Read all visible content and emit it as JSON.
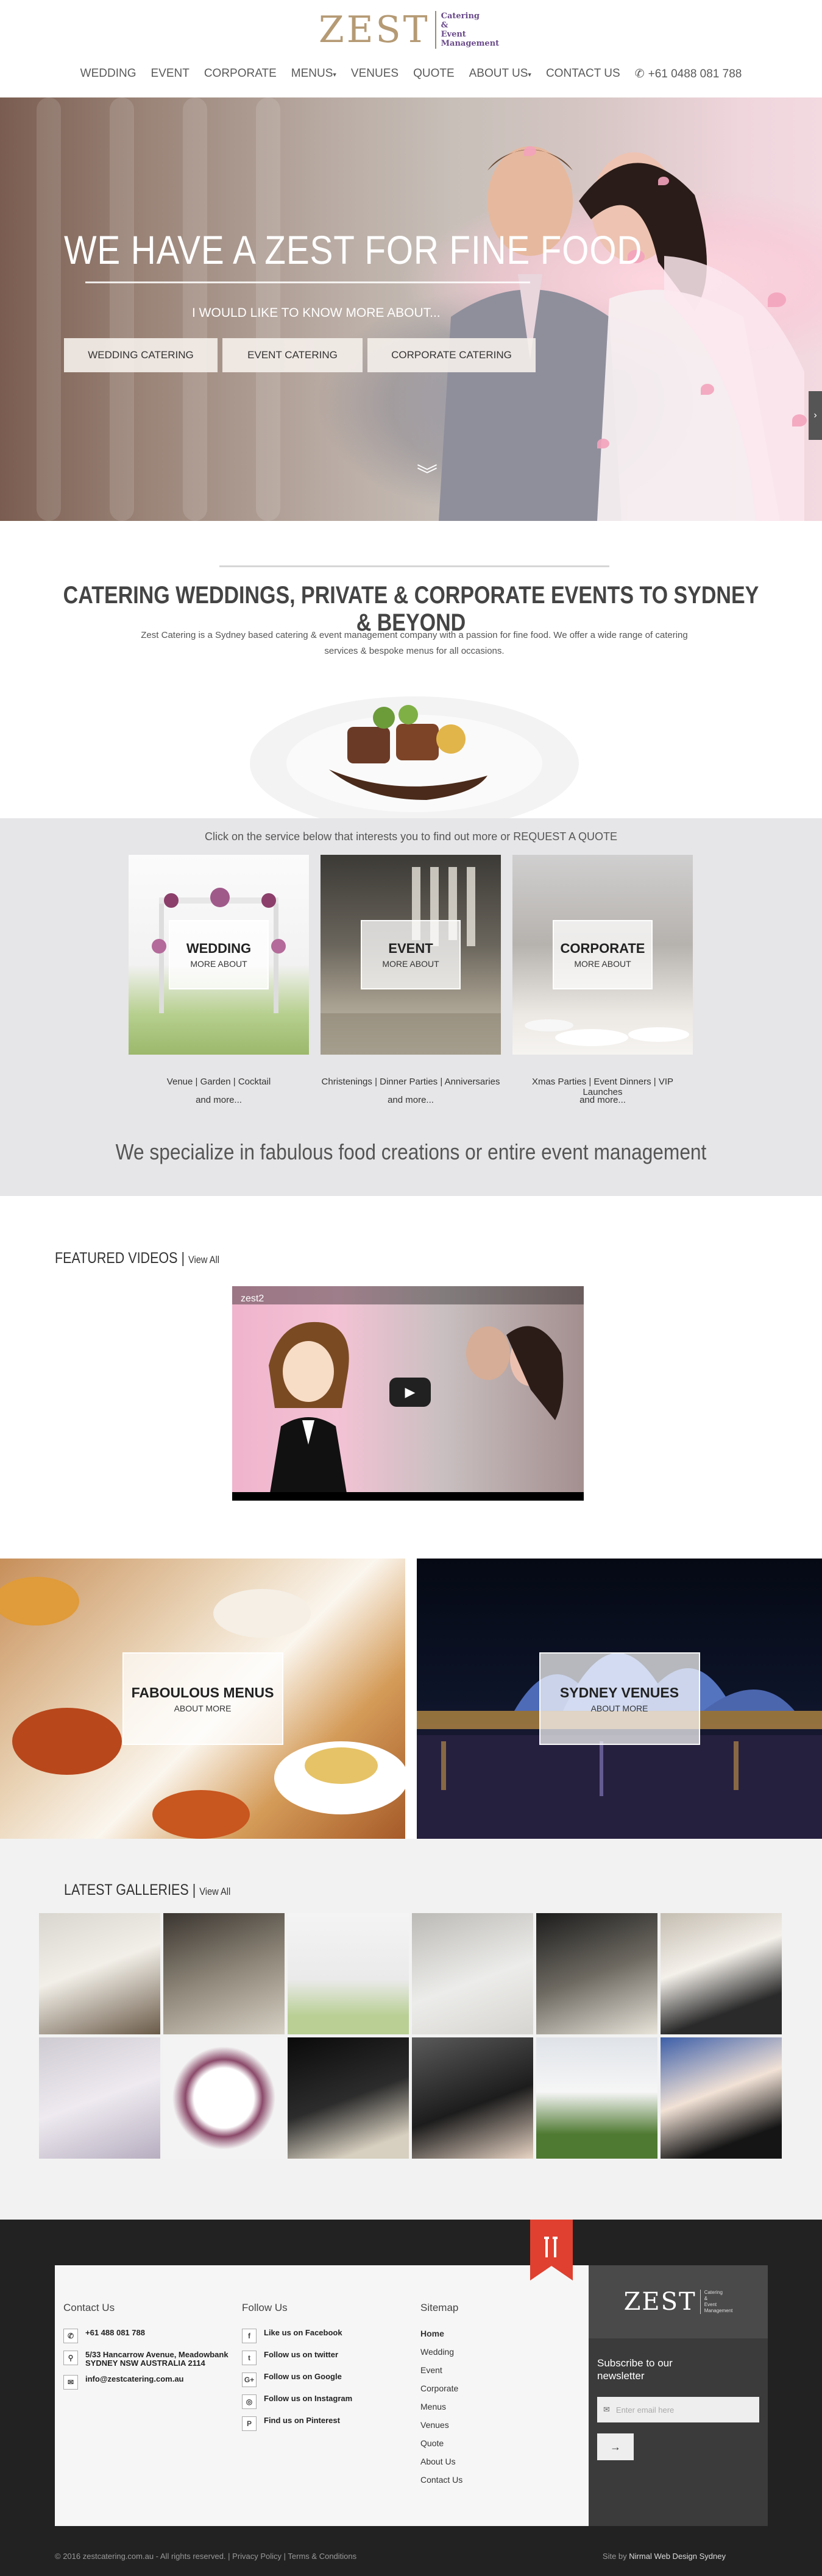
{
  "brand": {
    "name": "ZEST",
    "tagline": [
      "Catering",
      "&",
      "Event",
      "Management"
    ]
  },
  "nav": {
    "items": [
      {
        "label": "WEDDING",
        "dropdown": false
      },
      {
        "label": "EVENT",
        "dropdown": false
      },
      {
        "label": "CORPORATE",
        "dropdown": false
      },
      {
        "label": "MENUS",
        "dropdown": true
      },
      {
        "label": "VENUES",
        "dropdown": false
      },
      {
        "label": "QUOTE",
        "dropdown": false
      },
      {
        "label": "ABOUT US",
        "dropdown": true
      },
      {
        "label": "CONTACT US",
        "dropdown": false
      }
    ],
    "phone": "+61 0488 081 788"
  },
  "hero": {
    "title": "WE HAVE A ZEST FOR FINE FOOD",
    "subtitle": "I WOULD LIKE TO KNOW MORE ABOUT...",
    "buttons": [
      "WEDDING CATERING",
      "EVENT CATERING",
      "CORPORATE CATERING"
    ]
  },
  "intro": {
    "title": "CATERING WEDDINGS, PRIVATE & CORPORATE EVENTS TO SYDNEY & BEYOND",
    "text": "Zest Catering is a Sydney based catering & event management company with a passion for fine food. We offer a wide range of catering services & bespoke menus for all occasions."
  },
  "services": {
    "lead": "Click on the service below that interests you to find out more or REQUEST A QUOTE",
    "cards": [
      {
        "title": "WEDDING",
        "more": "MORE ABOUT",
        "tags": "Venue | Garden | Cocktail",
        "and_more": "and more..."
      },
      {
        "title": "EVENT",
        "more": "MORE ABOUT",
        "tags": "Christenings | Dinner Parties | Anniversaries",
        "and_more": "and more..."
      },
      {
        "title": "CORPORATE",
        "more": "MORE ABOUT",
        "tags": "Xmas Parties | Event Dinners | VIP Launches",
        "and_more": "and more..."
      }
    ],
    "tagline": "We specialize in fabulous food creations or entire event management"
  },
  "videos": {
    "heading": "FEATURED VIDEOS",
    "view_all": "View All",
    "video_title": "zest2"
  },
  "tiles": [
    {
      "title": "FABOULOUS MENUS",
      "more": "ABOUT MORE"
    },
    {
      "title": "SYDNEY VENUES",
      "more": "ABOUT MORE"
    }
  ],
  "galleries": {
    "heading": "LATEST GALLERIES",
    "view_all": "View All"
  },
  "footer": {
    "contact": {
      "heading": "Contact Us",
      "phone": "+61 488 081 788",
      "address": [
        "5/33 Hancarrow Avenue, Meadowbank",
        "SYDNEY NSW AUSTRALIA 2114"
      ],
      "email": "info@zestcatering.com.au"
    },
    "follow": {
      "heading": "Follow Us",
      "items": [
        {
          "icon": "facebook-icon",
          "glyph": "f",
          "label": "Like us on Facebook"
        },
        {
          "icon": "twitter-icon",
          "glyph": "t",
          "label": "Follow us on twitter"
        },
        {
          "icon": "google-icon",
          "glyph": "G+",
          "label": "Follow us on Google"
        },
        {
          "icon": "instagram-icon",
          "glyph": "◎",
          "label": "Follow us on Instagram"
        },
        {
          "icon": "pinterest-icon",
          "glyph": "P",
          "label": "Find us on Pinterest"
        }
      ]
    },
    "sitemap": {
      "heading": "Sitemap",
      "links": [
        "Home",
        "Wedding",
        "Event",
        "Corporate",
        "Menus",
        "Venues",
        "Quote",
        "About Us",
        "Contact Us"
      ]
    },
    "subscribe": {
      "title": "Subscribe to our newsletter",
      "placeholder": "Enter email here",
      "submit": "→"
    },
    "copyright": "© 2016 zestcatering.com.au - All rights reserved.  |  Privacy Policy  |  Terms & Conditions",
    "credit_prefix": "Site by",
    "credit_name": "Nirmal Web Design Sydney"
  }
}
